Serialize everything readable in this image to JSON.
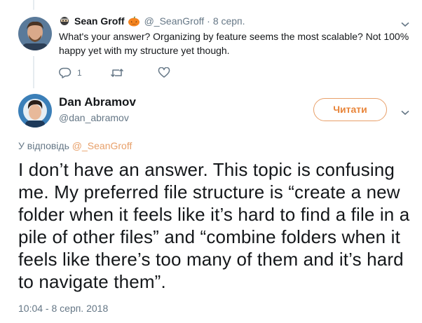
{
  "reply": {
    "author_name": "Sean Groff",
    "author_handle": "@_SeanGroff",
    "separator": "·",
    "date": "8 серп.",
    "text": "What's your answer? Organizing by feature seems the most scalable? Not 100% happy yet with my structure yet though.",
    "reply_count": "1",
    "retweet_count": "",
    "like_count": ""
  },
  "main": {
    "author_name": "Dan Abramov",
    "author_handle": "@dan_abramov",
    "follow_label": "Читати",
    "reply_to_prefix": "У відповідь",
    "reply_to_handle": "@_SeanGroff",
    "text": "I don’t have an answer. This topic is confusing me. My preferred file structure is “create a new folder when it feels like it’s hard to find a file in a pile of other files” and “combine folders when it feels like there’s too many of them and it’s hard to navigate them”.",
    "timestamp": "10:04 - 8 серп. 2018"
  },
  "colors": {
    "accent": "#e8853a",
    "secondary_text": "#657786",
    "primary_text": "#14171a",
    "divider": "#e6ecf0"
  },
  "icons": {
    "reply": "reply-icon",
    "retweet": "retweet-icon",
    "like": "heart-icon",
    "caret": "chevron-down-icon",
    "badge": "ninja-icon",
    "emoji": "pumpkin-icon"
  }
}
